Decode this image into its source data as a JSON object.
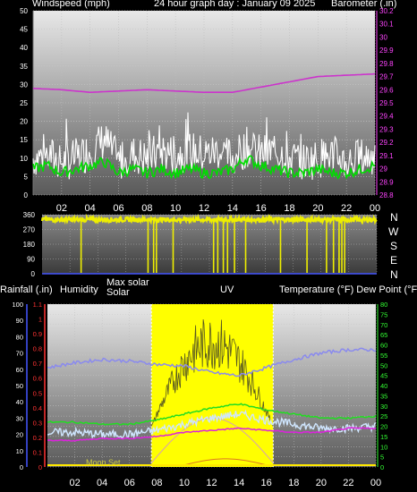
{
  "header": {
    "left": "Windspeed (mph)",
    "center": "24 hour graph day : January 09 2025",
    "right": "Barometer (.in)"
  },
  "wind_dir_labels": [
    "N",
    "W",
    "S",
    "E",
    "N"
  ],
  "bottom_header": {
    "rainfall": "Rainfall (.in)",
    "humidity": "Humidity",
    "solar_max": "Max solar",
    "solar": "Solar",
    "uv": "UV",
    "temp_dew": "Temperature (°F) Dew Point (°F)"
  },
  "moon_label": "Moon Set",
  "colors": {
    "wind": "#ffffff",
    "gust": "#00dd00",
    "barometer": "#cc33cc",
    "direction": "#eeee00",
    "humidity": "#8a8aee",
    "solar": "#ffff00",
    "temperature": "#22dd22",
    "dewpoint": "#dd22dd",
    "rainfall": "#dd2222"
  },
  "chart_data": [
    {
      "type": "line",
      "title": "24 hour graph day : January 09 2025",
      "x_ticks": [
        "02",
        "04",
        "06",
        "08",
        "10",
        "12",
        "14",
        "16",
        "18",
        "20",
        "22",
        "00"
      ],
      "xlim": [
        0,
        24
      ],
      "ylabel": "Windspeed (mph)",
      "ylim": [
        0,
        50
      ],
      "y_ticks": [
        0,
        5,
        10,
        15,
        20,
        25,
        30,
        35,
        40,
        45,
        50
      ],
      "y2label": "Barometer (.in)",
      "y2lim": [
        28.8,
        30.2
      ],
      "y2_ticks": [
        "28.8",
        "28.9",
        "29",
        "29.1",
        "29.2",
        "29.3",
        "29.4",
        "29.5",
        "29.6",
        "29.7",
        "29.8",
        "29.9",
        "30",
        "30.1",
        "30.2"
      ],
      "series": [
        {
          "name": "Barometer (.in)",
          "axis": "right",
          "x": [
            0,
            2,
            4,
            6,
            8,
            10,
            12,
            14,
            16,
            18,
            20,
            22,
            24
          ],
          "values": [
            29.61,
            29.6,
            29.58,
            29.59,
            29.6,
            29.59,
            29.58,
            29.58,
            29.62,
            29.66,
            29.7,
            29.71,
            29.72
          ]
        },
        {
          "name": "Windspeed (mph)",
          "axis": "left",
          "x": [
            0,
            1,
            2,
            3,
            4,
            5,
            6,
            7,
            8,
            9,
            10,
            11,
            12,
            13,
            14,
            15,
            16,
            17,
            18,
            19,
            20,
            21,
            22,
            23,
            24
          ],
          "values": [
            10,
            11,
            9,
            10,
            12,
            15,
            9,
            11,
            10,
            12,
            11,
            12,
            11,
            12,
            10,
            13,
            11,
            12,
            10,
            9,
            10,
            11,
            9,
            10,
            11
          ]
        },
        {
          "name": "Gust",
          "axis": "left",
          "x": [
            0,
            1,
            2,
            3,
            4,
            5,
            6,
            7,
            8,
            9,
            10,
            11,
            12,
            13,
            14,
            15,
            16,
            17,
            18,
            19,
            20,
            21,
            22,
            23,
            24
          ],
          "values": [
            7,
            8,
            6,
            7,
            8,
            9,
            6,
            7,
            6,
            7,
            6,
            7,
            6,
            6,
            7,
            10,
            8,
            7,
            6,
            6,
            7,
            6,
            6,
            7,
            8
          ]
        }
      ]
    },
    {
      "type": "line",
      "title": "",
      "ylabel": "",
      "ylim": [
        0,
        360
      ],
      "y_ticks": [
        0,
        90,
        180,
        270,
        360
      ],
      "series": [
        {
          "name": "",
          "values_note_x": [
            0,
            24
          ],
          "values": [
            330,
            330
          ],
          "drops_to_zero_at_hours": [
            2.8,
            7.6,
            8.0,
            8.2,
            9.4,
            12.3,
            12.6,
            13.0,
            13.3,
            13.8,
            14.6,
            17.1,
            19.0,
            20.4,
            20.9,
            21.3,
            21.5,
            21.7
          ]
        }
      ]
    },
    {
      "type": "line",
      "title": "",
      "y_ticks_temp": [
        0,
        5,
        10,
        15,
        20,
        25,
        30,
        35,
        40,
        45,
        50,
        55,
        60,
        65,
        70,
        75,
        80
      ],
      "ylim_temp": [
        0,
        80
      ],
      "y_ticks_humidity": [
        0,
        10,
        20,
        30,
        40,
        50,
        60,
        70,
        80,
        90,
        100
      ],
      "ylim_humidity": [
        0,
        100
      ],
      "y_ticks_rain": [
        "0",
        "0.1",
        "0.2",
        "0.3",
        "0.4",
        "0.5",
        "0.6",
        "0.7",
        "0.8",
        "0.9",
        "1",
        "1.1"
      ],
      "ylim_rain": [
        0,
        1.1
      ],
      "series": [
        {
          "name": "Humidity",
          "axis": "humidity",
          "x": [
            0,
            2,
            4,
            6,
            8,
            10,
            12,
            14,
            16,
            18,
            20,
            22,
            24
          ],
          "values": [
            61,
            64,
            66,
            65,
            63,
            62,
            58,
            56,
            61,
            66,
            70,
            72,
            72
          ]
        },
        {
          "name": "Temperature (°F)",
          "axis": "temp",
          "x": [
            0,
            2,
            4,
            6,
            8,
            10,
            12,
            14,
            16,
            18,
            20,
            22,
            24
          ],
          "values": [
            22,
            22,
            21,
            21,
            23,
            26,
            29,
            31,
            28,
            26,
            24,
            24,
            25
          ]
        },
        {
          "name": "Dew Point (°F)",
          "axis": "temp",
          "x": [
            0,
            2,
            4,
            6,
            8,
            10,
            12,
            14,
            16,
            18,
            20,
            22,
            24
          ],
          "values": [
            13,
            13,
            14,
            14,
            15,
            17,
            18,
            19,
            18,
            17,
            17,
            19,
            19
          ]
        },
        {
          "name": "Solar",
          "axis": "solar",
          "daylight_hours": [
            7.6,
            16.5
          ],
          "values_note": "solar radiation peaks near midday with strong fluctuations"
        },
        {
          "name": "Rainfall (.in)",
          "axis": "rain",
          "x": [
            0,
            24
          ],
          "values": [
            0,
            0
          ]
        }
      ]
    }
  ]
}
